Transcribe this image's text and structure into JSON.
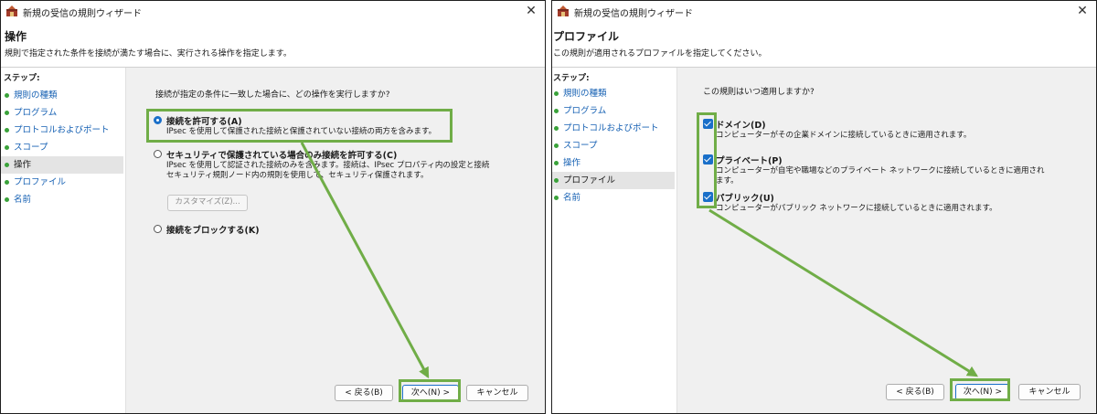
{
  "wizard_action": {
    "window_title": "新規の受信の規則ウィザード",
    "page_title": "操作",
    "page_description": "規則で指定された条件を接続が満たす場合に、実行される操作を指定します。",
    "steps_heading": "ステップ:",
    "steps": [
      {
        "label": "規則の種類",
        "current": false
      },
      {
        "label": "プログラム",
        "current": false
      },
      {
        "label": "プロトコルおよびポート",
        "current": false
      },
      {
        "label": "スコープ",
        "current": false
      },
      {
        "label": "操作",
        "current": true
      },
      {
        "label": "プロファイル",
        "current": false
      },
      {
        "label": "名前",
        "current": false
      }
    ],
    "question": "接続が指定の条件に一致した場合に、どの操作を実行しますか?",
    "options": [
      {
        "label": "接続を許可する(A)",
        "description": [
          "IPsec を使用して保護された接続と保護されていない接続の両方を含みます。"
        ],
        "selected": true
      },
      {
        "label": "セキュリティで保護されている場合のみ接続を許可する(C)",
        "description": [
          "IPsec を使用して認証された接続のみを含みます。接続は、IPsec プロパティ内の設定と接続",
          "セキュリティ規則ノード内の規則を使用して、セキュリティ保護されます。"
        ],
        "selected": false
      },
      {
        "label": "接続をブロックする(K)",
        "description": [],
        "selected": false
      }
    ],
    "customize_button": "カスタマイズ(Z)...",
    "buttons": {
      "back": "< 戻る(B)",
      "next": "次へ(N) >",
      "cancel": "キャンセル"
    }
  },
  "wizard_profile": {
    "window_title": "新規の受信の規則ウィザード",
    "page_title": "プロファイル",
    "page_description": "この規則が適用されるプロファイルを指定してください。",
    "steps_heading": "ステップ:",
    "steps": [
      {
        "label": "規則の種類",
        "current": false
      },
      {
        "label": "プログラム",
        "current": false
      },
      {
        "label": "プロトコルおよびポート",
        "current": false
      },
      {
        "label": "スコープ",
        "current": false
      },
      {
        "label": "操作",
        "current": false
      },
      {
        "label": "プロファイル",
        "current": true
      },
      {
        "label": "名前",
        "current": false
      }
    ],
    "question": "この規則はいつ適用しますか?",
    "profiles": [
      {
        "label": "ドメイン(D)",
        "description": [
          "コンピューターがその企業ドメインに接続しているときに適用されます。"
        ],
        "checked": true
      },
      {
        "label": "プライベート(P)",
        "description": [
          "コンピューターが自宅や職場などのプライベート ネットワークに接続しているときに適用され",
          "ます。"
        ],
        "checked": true
      },
      {
        "label": "パブリック(U)",
        "description": [
          "コンピューターがパブリック ネットワークに接続しているときに適用されます。"
        ],
        "checked": true
      }
    ],
    "buttons": {
      "back": "< 戻る(B)",
      "next": "次へ(N) >",
      "cancel": "キャンセル"
    }
  },
  "colors": {
    "highlight": "#70ad47",
    "link": "#1560b3",
    "accent": "#1a6fc9",
    "step_dot": "#3aa23a"
  },
  "icons": {
    "app": "firewall-wizard-icon",
    "close": "close-icon",
    "radio": "radio-icon",
    "checkbox": "checkbox-icon"
  }
}
